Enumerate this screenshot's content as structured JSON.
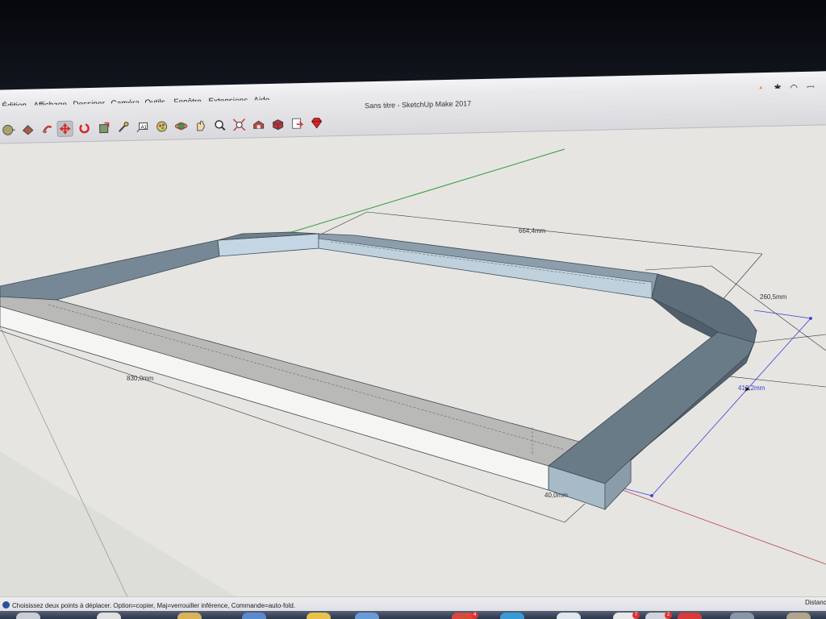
{
  "app": {
    "window_title": "Sans titre - SketchUp Make 2017"
  },
  "menubar": {
    "items": [
      "Édition",
      "Affichage",
      "Dessiner",
      "Caméra",
      "Outils",
      "Fenêtre",
      "Extensions",
      "Aide"
    ]
  },
  "status_icons": [
    "vlc-icon",
    "bluetooth-icon",
    "wifi-icon",
    "airplay-icon"
  ],
  "toolbar": {
    "tools": [
      "select-tool-icon",
      "paint-bucket-icon",
      "push-pull-icon",
      "move-tool-icon",
      "rotate-tool-icon",
      "scale-tool-icon",
      "tape-measure-icon",
      "text-tool-icon",
      "paint-icon",
      "orbit-icon",
      "pan-icon",
      "zoom-icon",
      "zoom-extents-icon",
      "warehouse-icon",
      "extension-warehouse-icon",
      "layout-icon",
      "ruby-icon"
    ],
    "active_tool": "move-tool-icon"
  },
  "viewport": {
    "dimensions": {
      "top_length": "664,4mm",
      "side_length": "830,0mm",
      "corner_length": "260,5mm",
      "width": "40,0mm",
      "moving_length": "412,2mm"
    }
  },
  "statusbar": {
    "message": "Choisissez deux points à déplacer. Option=copier, Maj=verrouiller inférence, Commande=auto-fold.",
    "vcb_label": "Distance"
  },
  "dock": {
    "badges": [
      "4",
      "7",
      "2"
    ]
  },
  "colors": {
    "background": "#e6e5e2",
    "top_face": "#9aaab7",
    "dark_face": "#6e7f8c",
    "light_face": "#f3f3f1",
    "axis_green": "#2d9b3a",
    "axis_red": "#b44a4a",
    "inference_blue": "#3a3adb"
  }
}
